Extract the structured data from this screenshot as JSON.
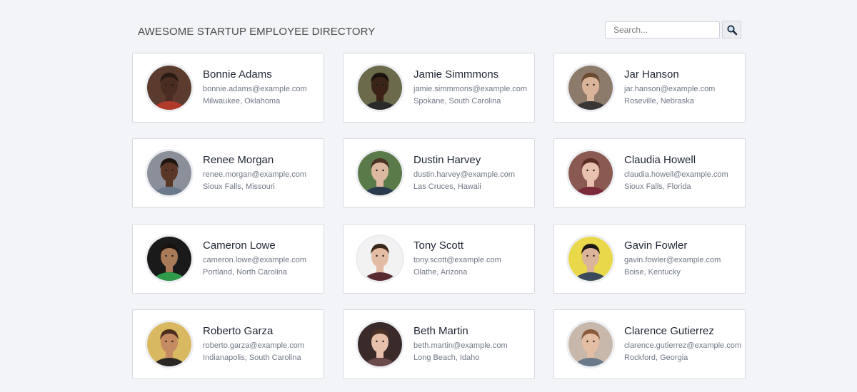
{
  "header": {
    "title": "AWESOME STARTUP EMPLOYEE DIRECTORY"
  },
  "search": {
    "placeholder": "Search...",
    "button_icon": "search-icon"
  },
  "employees": [
    {
      "name": "Bonnie Adams",
      "email": "bonnie.adams@example.com",
      "location": "Milwaukee, Oklahoma",
      "bg": "#5a3b2e",
      "skin": "#4a2c22",
      "hair": "#2a1a14",
      "shirt": "#b23a2a"
    },
    {
      "name": "Jamie Simmmons",
      "email": "jamie.simmmons@example.com",
      "location": "Spokane, South Carolina",
      "bg": "#6b6a4a",
      "skin": "#3a2418",
      "hair": "#1a120e",
      "shirt": "#2a2a2a"
    },
    {
      "name": "Jar Hanson",
      "email": "jar.hanson@example.com",
      "location": "Roseville, Nebraska",
      "bg": "#8c7a6a",
      "skin": "#d9b39a",
      "hair": "#6b4a32",
      "shirt": "#3a3636"
    },
    {
      "name": "Renee Morgan",
      "email": "renee.morgan@example.com",
      "location": "Sioux Falls, Missouri",
      "bg": "#8a8f9a",
      "skin": "#5a3626",
      "hair": "#1e1410",
      "shirt": "#6a7a8a"
    },
    {
      "name": "Dustin Harvey",
      "email": "dustin.harvey@example.com",
      "location": "Las Cruces, Hawaii",
      "bg": "#5b7a4a",
      "skin": "#dcb8a0",
      "hair": "#4a3224",
      "shirt": "#2a3a4e"
    },
    {
      "name": "Claudia Howell",
      "email": "claudia.howell@example.com",
      "location": "Sioux Falls, Florida",
      "bg": "#8a5a52",
      "skin": "#e8c2ae",
      "hair": "#5a2e22",
      "shirt": "#7a2a3a"
    },
    {
      "name": "Cameron Lowe",
      "email": "cameron.lowe@example.com",
      "location": "Portland, North Carolina",
      "bg": "#1a1a1a",
      "skin": "#a87a58",
      "hair": "#1a120e",
      "shirt": "#2e9a4a"
    },
    {
      "name": "Tony Scott",
      "email": "tony.scott@example.com",
      "location": "Olathe, Arizona",
      "bg": "#f2f2f2",
      "skin": "#e2bca4",
      "hair": "#3a2618",
      "shirt": "#5a2a32"
    },
    {
      "name": "Gavin Fowler",
      "email": "gavin.fowler@example.com",
      "location": "Boise, Kentucky",
      "bg": "#e8d84a",
      "skin": "#dcb49a",
      "hair": "#1e1814",
      "shirt": "#3a4a5a"
    },
    {
      "name": "Roberto Garza",
      "email": "roberto.garza@example.com",
      "location": "Indianapolis, South Carolina",
      "bg": "#d8b860",
      "skin": "#c48a62",
      "hair": "#4a2e1e",
      "shirt": "#2a2624"
    },
    {
      "name": "Beth Martin",
      "email": "beth.martin@example.com",
      "location": "Long Beach, Idaho",
      "bg": "#3a2a2a",
      "skin": "#e6c0aa",
      "hair": "#4a3024",
      "shirt": "#6a4a4a"
    },
    {
      "name": "Clarence Gutierrez",
      "email": "clarence.gutierrez@example.com",
      "location": "Rockford, Georgia",
      "bg": "#c8b8ac",
      "skin": "#e4bea4",
      "hair": "#8a5a3a",
      "shirt": "#6a7a8a"
    }
  ]
}
